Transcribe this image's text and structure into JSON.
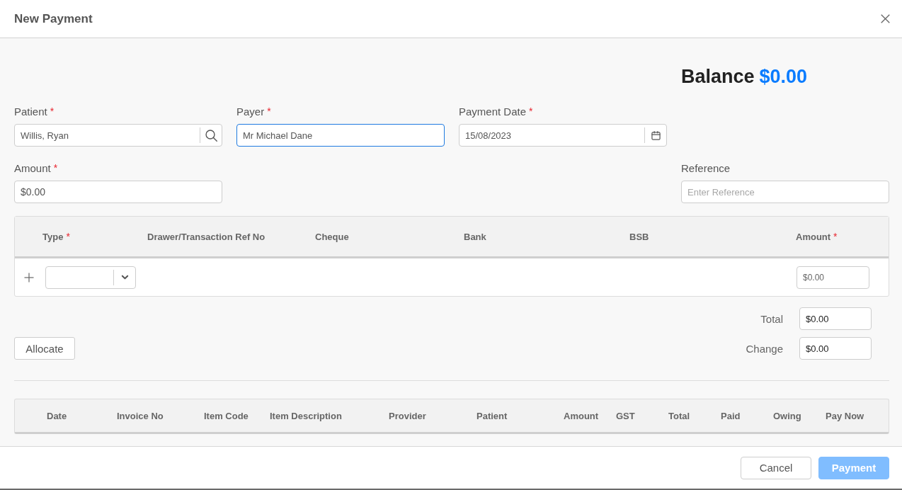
{
  "dialog": {
    "title": "New Payment"
  },
  "balance": {
    "label": "Balance",
    "value": "$0.00"
  },
  "form_rows": [
    {
      "fields": [
        {
          "kind": "search",
          "label": "Patient",
          "required_mark": "*",
          "value": "Willis, Ryan",
          "focused": false
        },
        {
          "kind": "text",
          "label": "Payer",
          "required_mark": "*",
          "value": "Mr Michael Dane",
          "focused": true
        },
        {
          "kind": "date",
          "label": "Payment Date",
          "required_mark": "*",
          "value": "15/08/2023",
          "focused": false
        }
      ]
    },
    {
      "fields": [
        {
          "kind": "amount",
          "label": "Amount",
          "required_mark": "*",
          "value": "$0.00",
          "focused": false
        },
        {
          "kind": "text",
          "label": "Reference",
          "placeholder": "Enter Reference",
          "focused": false
        }
      ]
    }
  ],
  "payment_table": {
    "columns": [
      {
        "label": "Type",
        "required_mark": "*"
      },
      {
        "label": "Drawer/Transaction Ref No"
      },
      {
        "label": "Cheque"
      },
      {
        "label": "Bank"
      },
      {
        "label": "BSB"
      },
      {
        "label": "Amount",
        "required_mark": "*"
      }
    ],
    "rows": [
      {
        "amount": "$0.00"
      }
    ]
  },
  "allocate_button": {
    "label": "Allocate"
  },
  "totals": [
    {
      "label": "Total",
      "value": "$0.00"
    },
    {
      "label": "Change",
      "value": "$0.00"
    }
  ],
  "invoice_table": {
    "columns": [
      "Date",
      "Invoice No",
      "Item Code",
      "Item Description",
      "Provider",
      "Patient",
      "Amount",
      "GST",
      "Total",
      "Paid",
      "Owing",
      "Pay Now"
    ]
  },
  "footer_buttons": [
    {
      "kind": "secondary",
      "label": "Cancel",
      "disabled": false
    },
    {
      "kind": "primary",
      "label": "Payment",
      "disabled": true
    }
  ]
}
